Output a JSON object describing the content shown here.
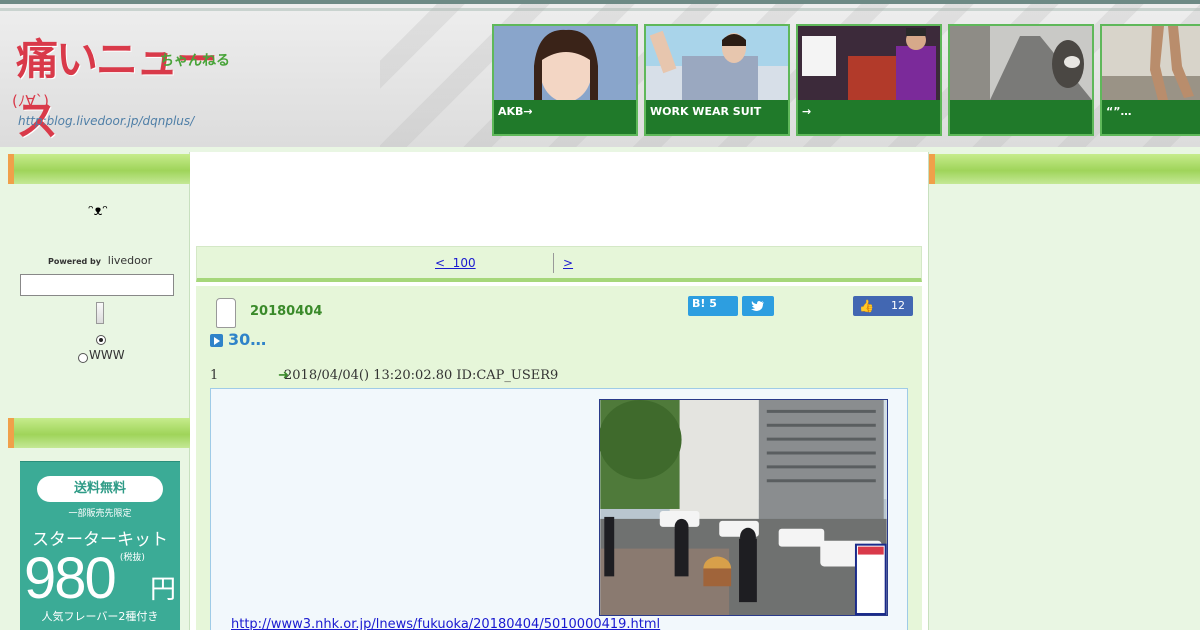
{
  "header": {
    "logo_main": "痛いニュース",
    "logo_sub": "ちゃんねる",
    "logo_face": "(ﾉ∀`)",
    "logo_url": "http:blog.livedoor.jp/dqnplus/",
    "featured": [
      {
        "caption": "AKB→"
      },
      {
        "caption": "WORK WEAR SUIT"
      },
      {
        "caption": "→"
      },
      {
        "caption": ""
      },
      {
        "caption": "“”…"
      }
    ]
  },
  "left_sidebar": {
    "smiley": "ᵔᴥᵔ",
    "powered_by": "Powered by",
    "powered_brand": "livedoor",
    "radio_web_label": "WWW",
    "ad": {
      "free_shipping": "送料無料",
      "limited": "一部販売先限定",
      "kit": "スターターキット",
      "price": "980",
      "yen": "円",
      "tax": "(税抜)",
      "flavor": "人気フレーバー2種付き"
    }
  },
  "pager": {
    "prev_label": "<  100",
    "next_label": ">"
  },
  "article": {
    "date": "20180404",
    "hatena_label": "B!",
    "hatena_count": "5",
    "tweet_icon": "bird-icon",
    "like_count": "12",
    "title": "30…",
    "res_number": "1",
    "res_meta": "2018/04/04() 13:20:02.80 ID:CAP_USER9",
    "link": "http://www3.nhk.or.jp/lnews/fukuoka/20180404/5010000419.html"
  },
  "colors": {
    "accent_green": "#3a8a2a",
    "link_blue": "#1a1ad0",
    "title_blue": "#2f83c9",
    "hatena_blue": "#2d9ee0",
    "facebook_blue": "#4267b2",
    "ad_teal": "#3bab96"
  }
}
